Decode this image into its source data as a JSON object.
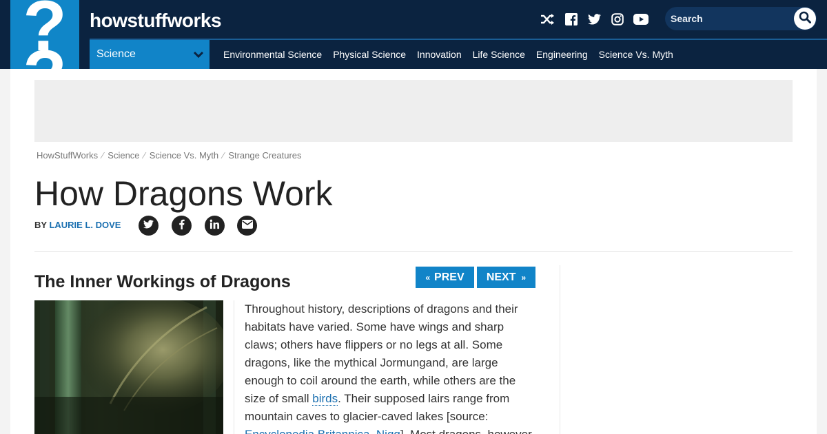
{
  "header": {
    "logo_mark": "?",
    "brand": "howstuffworks",
    "social_icons": [
      "shuffle-icon",
      "facebook-icon",
      "twitter-icon",
      "instagram-icon",
      "youtube-icon"
    ],
    "search_placeholder": "Search",
    "category": "Science",
    "nav": [
      "Environmental Science",
      "Physical Science",
      "Innovation",
      "Life Science",
      "Engineering",
      "Science Vs. Myth"
    ]
  },
  "breadcrumbs": [
    "HowStuffWorks",
    "Science",
    "Science Vs. Myth",
    "Strange Creatures"
  ],
  "article": {
    "title": "How Dragons Work",
    "by_label": "BY",
    "author": "LAURIE L. DOVE",
    "share_icons": [
      "twitter-icon",
      "facebook-icon",
      "linkedin-icon",
      "email-icon"
    ],
    "section_title": "The Inner Workings of Dragons",
    "prev_label": "PREV",
    "next_label": "NEXT",
    "body_1": "Throughout history, descriptions of dragons and their habitats have varied. Some have wings and sharp claws; others have flippers or no legs at all. Some dragons, like the mythical Jormungand, are large enough to coil around the earth, while others are the size of small ",
    "body_link_1": "birds",
    "body_2": ". Their supposed lairs range from mountain caves to glacier-caved lakes [source: ",
    "body_link_2": "Encyclopedia Britannica",
    "body_3": ", ",
    "body_link_3": "Nigg",
    "body_4": "]. Most dragons, however"
  },
  "colors": {
    "header_bg": "#0b2340",
    "brand_blue": "#1184c8",
    "link": "#1a6fb0"
  }
}
